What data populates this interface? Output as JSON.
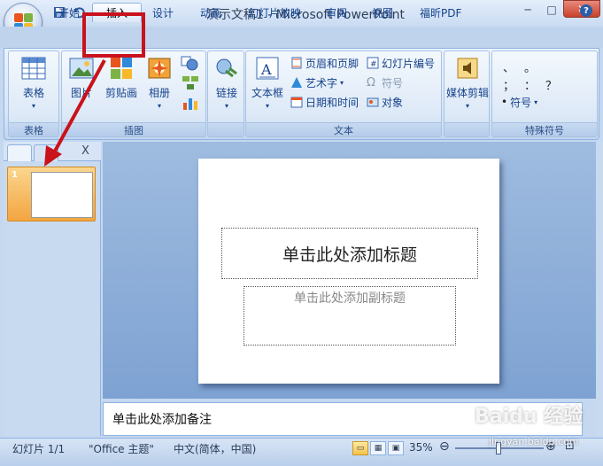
{
  "window": {
    "title": "演示文稿1 - Microsoft PowerPoint",
    "minimize_symbol": "─",
    "maximize_symbol": "□",
    "close_symbol": "✕"
  },
  "qat": {
    "save_icon": "save-icon",
    "undo_icon": "undo-icon",
    "redo_icon": "redo-icon"
  },
  "tabs": [
    {
      "label": "开始"
    },
    {
      "label": "插入",
      "active": true
    },
    {
      "label": "设计"
    },
    {
      "label": "动画"
    },
    {
      "label": "幻灯片放映"
    },
    {
      "label": "审阅"
    },
    {
      "label": "视图"
    },
    {
      "label": "福昕PDF"
    }
  ],
  "ribbon": {
    "groups": {
      "table": {
        "label": "表格",
        "button": "表格"
      },
      "illustrations": {
        "label": "插图",
        "picture": "图片",
        "clipart": "剪贴画",
        "album": "相册"
      },
      "links": {
        "button": "链接"
      },
      "text": {
        "label": "文本",
        "textbox": "文本框",
        "header_footer": "页眉和页脚",
        "wordart": "艺术字",
        "datetime": "日期和时间",
        "slide_number": "幻灯片编号",
        "symbol": "符号",
        "object": "对象"
      },
      "media": {
        "button": "媒体剪辑"
      },
      "special_symbols": {
        "label": "特殊符号",
        "glyphs": [
          "、",
          "。",
          "；",
          "：",
          "？",
          "•"
        ],
        "button": "符号"
      }
    }
  },
  "left_pane": {
    "slide_number": "1",
    "close_symbol": "X"
  },
  "slide": {
    "title_placeholder": "单击此处添加标题",
    "subtitle_placeholder": "单击此处添加副标题"
  },
  "notes": {
    "placeholder": "单击此处添加备注"
  },
  "statusbar": {
    "slide_info": "幻灯片 1/1",
    "theme": "\"Office 主题\"",
    "language": "中文(简体，中国)",
    "zoom": "35%"
  },
  "watermark": {
    "brand": "Baidu 经验",
    "url": "jingyan.baidu.com"
  },
  "colors": {
    "highlight": "#c9121b",
    "ribbon_bg": "#dfeaf7",
    "accent": "#15428b"
  }
}
